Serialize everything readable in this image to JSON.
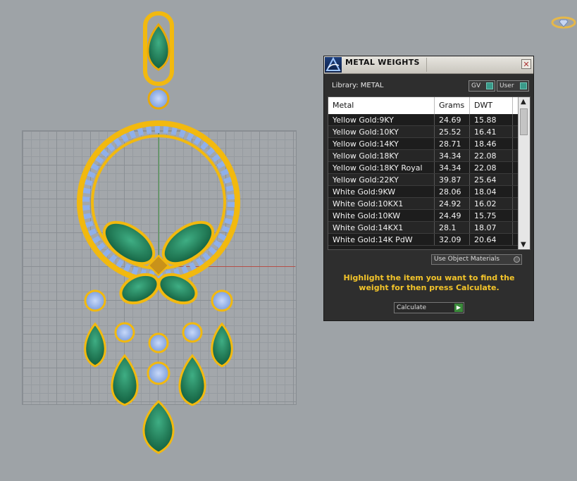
{
  "panel": {
    "title": "METAL WEIGHTS",
    "close_glyph": "✕",
    "library_label": "Library: METAL",
    "gv_label": "GV",
    "user_label": "User",
    "columns": {
      "metal": "Metal",
      "grams": "Grams",
      "dwt": "DWT"
    },
    "rows": [
      {
        "metal": "Yellow Gold:9KY",
        "grams": "24.69",
        "dwt": "15.88"
      },
      {
        "metal": "Yellow Gold:10KY",
        "grams": "25.52",
        "dwt": "16.41"
      },
      {
        "metal": "Yellow Gold:14KY",
        "grams": "28.71",
        "dwt": "18.46"
      },
      {
        "metal": "Yellow Gold:18KY",
        "grams": "34.34",
        "dwt": "22.08"
      },
      {
        "metal": "Yellow Gold:18KY Royal",
        "grams": "34.34",
        "dwt": "22.08"
      },
      {
        "metal": "Yellow Gold:22KY",
        "grams": "39.87",
        "dwt": "25.64"
      },
      {
        "metal": "White Gold:9KW",
        "grams": "28.06",
        "dwt": "18.04"
      },
      {
        "metal": "White Gold:10KX1",
        "grams": "24.92",
        "dwt": "16.02"
      },
      {
        "metal": "White Gold:10KW",
        "grams": "24.49",
        "dwt": "15.75"
      },
      {
        "metal": "White Gold:14KX1",
        "grams": "28.1",
        "dwt": "18.07"
      },
      {
        "metal": "White Gold:14K PdW",
        "grams": "32.09",
        "dwt": "20.64"
      }
    ],
    "scroll_up_glyph": "▲",
    "scroll_down_glyph": "▼",
    "use_object_materials": "Use Object Materials",
    "instructions": "Highlight the item you want to find the weight for then press Calculate.",
    "calculate_label": "Calculate",
    "calculate_glyph": "▶"
  },
  "colors": {
    "viewport_bg": "#9ea3a7",
    "panel_bg": "#2e2e2e",
    "instruction_text": "#f4c52a",
    "gold": "#f2b90f",
    "emerald": "#1f7a55",
    "sapphire": "#8fb0ea"
  },
  "icons": {
    "app_logo": "app-logo-icon",
    "corner_logo": "diamond-ring-icon"
  }
}
